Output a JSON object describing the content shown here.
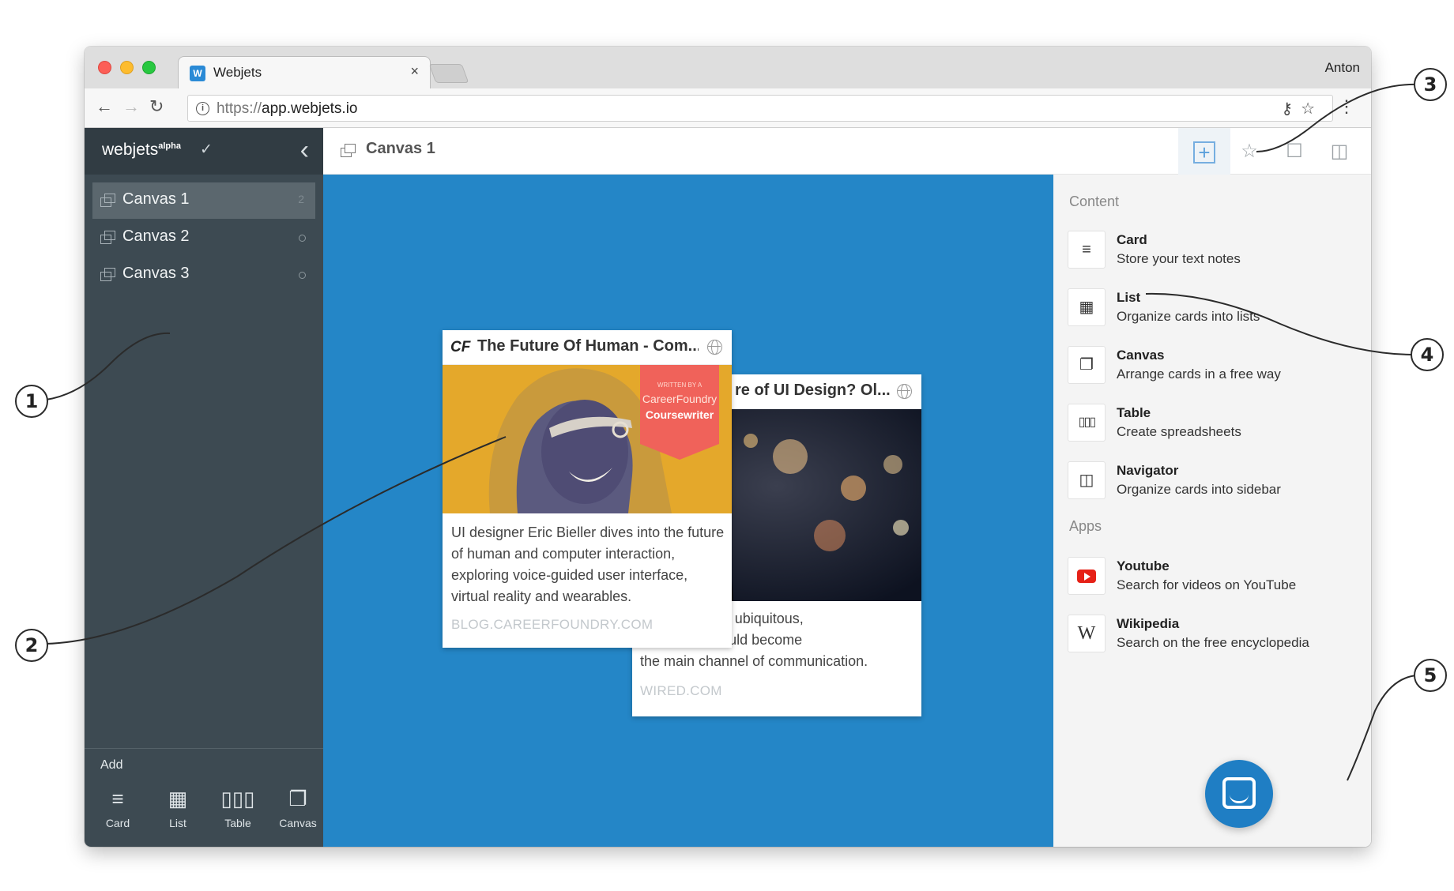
{
  "browser": {
    "tab_title": "Webjets",
    "tab_favicon": "W",
    "tab_close": "×",
    "profile_name": "Anton",
    "url_scheme": "https://",
    "url_host": "app.webjets.io"
  },
  "sidebar": {
    "logo": "webjets",
    "logo_sup": "alpha",
    "canvases": [
      {
        "label": "Canvas 1",
        "count": "2",
        "active": true
      },
      {
        "label": "Canvas 2",
        "active": false
      },
      {
        "label": "Canvas 3",
        "active": false
      }
    ],
    "add_label": "Add",
    "add_buttons": [
      {
        "label": "Card",
        "icon": "lines-icon"
      },
      {
        "label": "List",
        "icon": "grid-icon"
      },
      {
        "label": "Table",
        "icon": "columns-icon"
      },
      {
        "label": "Canvas",
        "icon": "stack-icon"
      }
    ]
  },
  "main": {
    "title": "Canvas 1",
    "header_buttons": [
      "add-icon",
      "star-icon",
      "inbox-icon",
      "trash-icon",
      "user-icon"
    ]
  },
  "cards": [
    {
      "logo": "CF",
      "title": "The Future Of Human - Com...",
      "badge_small": "WRITTEN BY A",
      "badge_mid": "CareerFoundry",
      "badge_big": "Coursewriter",
      "text": "UI designer Eric Bieller dives into the future of human and computer interaction, exploring voice-guided user interface, virtual reality and wearables.",
      "source": "BLOG.CAREERFOUNDRY.COM"
    },
    {
      "title": "re of UI Design? Ol...",
      "text_lines": [
        "y, familiar, and ubiquitous,",
        "ense that it could become",
        "the main channel of communication."
      ],
      "source": "WIRED.COM"
    }
  ],
  "panel": {
    "content_label": "Content",
    "apps_label": "Apps",
    "content_items": [
      {
        "name": "Card",
        "desc": "Store your text notes",
        "icon": "lines-icon"
      },
      {
        "name": "List",
        "desc": "Organize cards into lists",
        "icon": "grid-icon"
      },
      {
        "name": "Canvas",
        "desc": "Arrange cards in a free way",
        "icon": "stack-icon"
      },
      {
        "name": "Table",
        "desc": "Create spreadsheets",
        "icon": "columns-icon"
      },
      {
        "name": "Navigator",
        "desc": "Organize cards into sidebar",
        "icon": "navigator-icon"
      }
    ],
    "app_items": [
      {
        "name": "Youtube",
        "desc": "Search for videos on YouTube",
        "icon": "youtube-icon"
      },
      {
        "name": "Wikipedia",
        "desc": "Search on the free encyclopedia",
        "icon": "wikipedia-icon",
        "glyph": "W"
      }
    ]
  },
  "callouts": [
    "1",
    "2",
    "3",
    "4",
    "5"
  ],
  "colors": {
    "sidebar": "#3d4a52",
    "canvas": "#2486c7",
    "accent": "#1f7ec4",
    "badge": "#f0625a"
  }
}
